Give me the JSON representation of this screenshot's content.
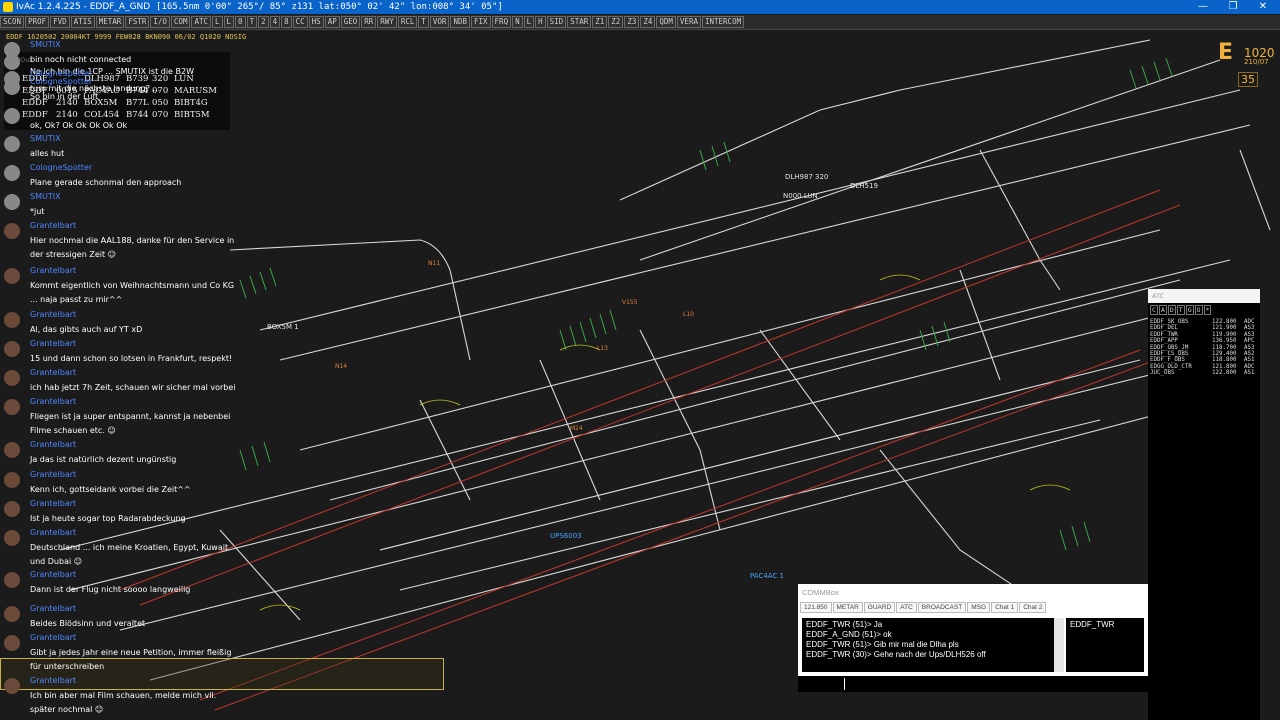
{
  "window": {
    "title": "IvAc 1.2.4.225 - EDDF_A_GND",
    "coords": "[165.5nm   0'00\"  265°/ 85°   z131   lat:050° 02' 42\"  lon:008° 34' 05\"]",
    "buttons": [
      "—",
      "❐",
      "✕"
    ]
  },
  "toolbar": [
    "SCON",
    "PROF",
    "FVD",
    "ATIS",
    "METAR",
    "FSTR",
    "I/O",
    "COM",
    "ATC",
    "L",
    "L",
    "0",
    "T",
    "2",
    "4",
    "8",
    "CC",
    "HS",
    "AP",
    "GEO",
    "RR",
    "RWY",
    "RCL",
    "T",
    "VOR",
    "NDB",
    "FIX",
    "FRQ",
    "N",
    "L",
    "H",
    "SID",
    "STAR",
    "Z1",
    "Z2",
    "Z3",
    "Z4",
    "QDM",
    "VERA",
    "INTERCOM"
  ],
  "metar": "EDDF 1620502 20004KT 9999 FEW028 BKN090 06/02 Q1020 NOSIG",
  "wind": {
    "letter": "E",
    "qnh": "1020",
    "wind": "210/07",
    "rvr": "35"
  },
  "strips": {
    "header": "In/Out",
    "rows": [
      {
        "apt": "EDDF",
        "time": "",
        "cs": "DLH987",
        "type": "B739",
        "fl": "320",
        "dest": "LUN"
      },
      {
        "apt": "EDDF",
        "time": "0015",
        "cs": "PAC4AC",
        "type": "B744",
        "fl": "070",
        "dest": "MARUSM"
      },
      {
        "apt": "EDDF",
        "time": "2140",
        "cs": "BOX5M",
        "type": "B77L",
        "fl": "050",
        "dest": "BIBT4G"
      },
      {
        "apt": "EDDF",
        "time": "2140",
        "cs": "COL454",
        "type": "B744",
        "fl": "070",
        "dest": "BIBT5M"
      }
    ]
  },
  "chat": {
    "messages": [
      {
        "author": "SMUTIX",
        "text": "bin noch nicht connected"
      },
      {
        "author": "",
        "text": "Ne ich bin die 1CP ... SMUTIX ist die B2W"
      },
      {
        "author": "CologneSpotter",
        "text": "tum mit die nächste landung? ..."
      },
      {
        "author": "CologneSpotter",
        "text": "So bin in der Luft"
      },
      {
        "author": "",
        "text": "ok, Ok? Ok Ok Ok Ok Ok"
      },
      {
        "author": "SMUTIX",
        "text": "alles hut"
      },
      {
        "author": "CologneSpotter",
        "text": "Plane gerade schonmal den approach"
      },
      {
        "author": "SMUTIX",
        "text": "*jut"
      },
      {
        "author": "Grantelbart",
        "text": "Hier nochmal die AAL188, danke für den Service in der stressigen Zeit ☺"
      },
      {
        "author": "Grantelbart",
        "text": "Kommt eigentlich von Weihnachtsmann und Co KG ... naja passt zu mir^^"
      },
      {
        "author": "Grantelbart",
        "text": "Al, das gibts auch auf YT xD"
      },
      {
        "author": "Grantelbart",
        "text": "15 und dann schon so lotsen in Frankfurt, respekt!"
      },
      {
        "author": "Grantelbart",
        "text": "ich hab jetzt 7h Zeit, schauen wir sicher mal vorbei"
      },
      {
        "author": "Grantelbart",
        "text": "Fliegen ist ja super entspannt, kannst ja nebenbei Filme schauen etc. ☺"
      },
      {
        "author": "Grantelbart",
        "text": "Ja das ist natürlich dezent ungünstig"
      },
      {
        "author": "Grantelbart",
        "text": "Kenn ich, gottseidank vorbei die Zeit^^"
      },
      {
        "author": "Grantelbart",
        "text": "Ist ja heute sogar top Radarabdeckung"
      },
      {
        "author": "Grantelbart",
        "text": "Deutschland ... ich meine Kroatien, Egypt, Kuwait und Dubai ☺"
      },
      {
        "author": "Grantelbart",
        "text": "Dann ist der Flug nicht soooo langweilig"
      },
      {
        "author": "Grantelbart",
        "text": "Beides Blödsinn und veraltet"
      },
      {
        "author": "Grantelbart",
        "text": "Gibt ja jedes Jahr eine neue Petition, immer fleißig für unterschreiben"
      },
      {
        "author": "Grantelbart",
        "text": "Ich bin aber mal Film schauen, melde mich vll. später nochmal ☺"
      }
    ]
  },
  "radar": {
    "labels": [
      {
        "text": "DLH987"
      },
      {
        "text": "320"
      },
      {
        "text": "N000 LUN"
      },
      {
        "text": "DLH519"
      },
      {
        "text": "BOX5M 1"
      },
      {
        "text": "UPS6003"
      },
      {
        "text": "PAC4AC 1"
      },
      {
        "text": "V155"
      },
      {
        "text": "M24"
      },
      {
        "text": "L13"
      },
      {
        "text": "L10"
      },
      {
        "text": "N11"
      },
      {
        "text": "N14"
      }
    ]
  },
  "atc": {
    "title": "ATC",
    "tabs": [
      "C",
      "A",
      "D",
      "T",
      "G",
      "O",
      "*"
    ],
    "list": [
      {
        "cs": "EDDF_SK_OBS",
        "freq": "122.800",
        "r": "ADC"
      },
      {
        "cs": "EDDF_DEL",
        "freq": "121.900",
        "r": "AS3"
      },
      {
        "cs": "EDDF_TWR",
        "freq": "119.900",
        "r": "AS3"
      },
      {
        "cs": "EDDF_APP",
        "freq": "136.950",
        "r": "APC"
      },
      {
        "cs": "EDDF_OBS_JM",
        "freq": "118.700",
        "r": "AS3"
      },
      {
        "cs": "EDDF_CS_OBS",
        "freq": "129.400",
        "r": "AS2"
      },
      {
        "cs": "EDDF_F_OBS",
        "freq": "118.800",
        "r": "AS1"
      },
      {
        "cs": "EDGG_DLD_CTR",
        "freq": "121.800",
        "r": "ADC"
      },
      {
        "cs": "JUC_OBS",
        "freq": "122.800",
        "r": "AS1"
      }
    ]
  },
  "commbox": {
    "title": "COMMBox",
    "tabs": [
      "121.850",
      "METAR",
      "GUARD",
      "ATC",
      "BROADCAST",
      "MSG",
      "Chat 1",
      "Chat 2"
    ],
    "log": [
      "EDDF_TWR (51)> Ja",
      "EDDF_A_GND (51)> ok",
      "EDDF_TWR (51)> Gib mir mal die Dlha pls",
      "EDDF_TWR (30)> Gehe nach der Ups/DLH526 off"
    ],
    "side": "EDDF_TWR"
  }
}
